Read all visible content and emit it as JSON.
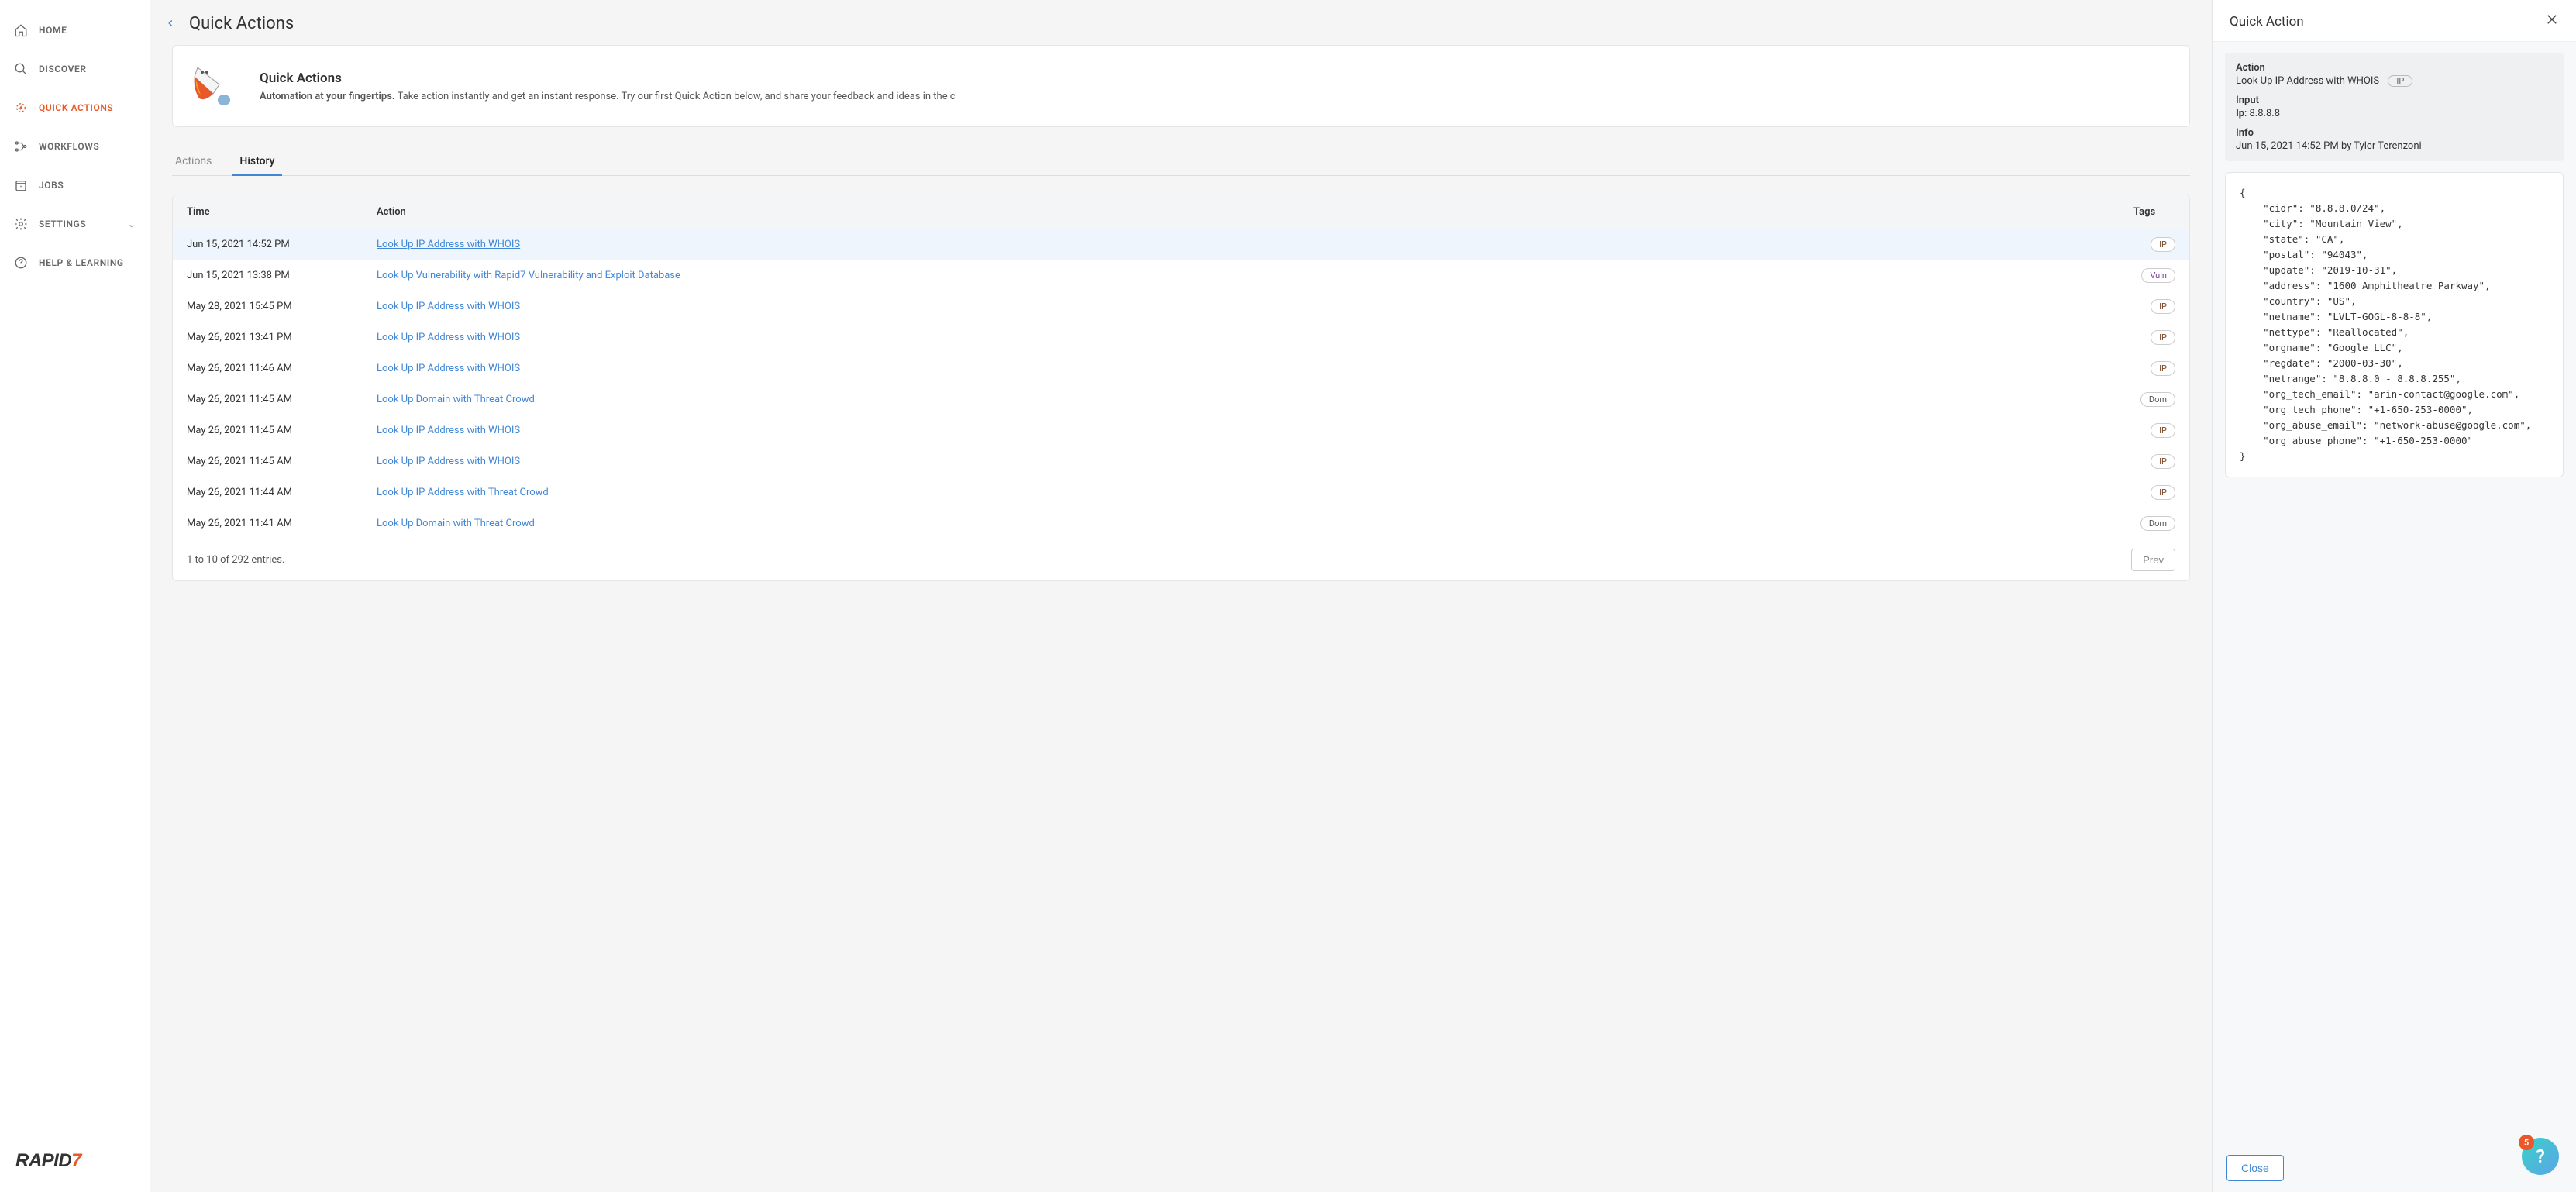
{
  "sidebar": {
    "items": [
      {
        "label": "HOME",
        "icon": "home-icon"
      },
      {
        "label": "DISCOVER",
        "icon": "search-icon"
      },
      {
        "label": "QUICK ACTIONS",
        "icon": "spark-icon"
      },
      {
        "label": "WORKFLOWS",
        "icon": "workflow-icon"
      },
      {
        "label": "JOBS",
        "icon": "jobs-icon"
      },
      {
        "label": "SETTINGS",
        "icon": "gear-icon"
      },
      {
        "label": "HELP & LEARNING",
        "icon": "help-icon"
      }
    ],
    "logo": {
      "name": "RAPID",
      "accent": "7"
    }
  },
  "header": {
    "title": "Quick Actions"
  },
  "banner": {
    "title": "Quick Actions",
    "lead": "Automation at your fingertips.",
    "body": "Take action instantly and get an instant response. Try our first Quick Action below, and share your feedback and ideas in the c"
  },
  "tabs": {
    "actions": "Actions",
    "history": "History"
  },
  "table": {
    "headers": {
      "time": "Time",
      "action": "Action",
      "tags": "Tags"
    },
    "rows": [
      {
        "time": "Jun 15, 2021 14:52 PM",
        "action": "Look Up IP Address with WHOIS",
        "tag": "IP",
        "selected": true
      },
      {
        "time": "Jun 15, 2021 13:38 PM",
        "action": "Look Up Vulnerability with Rapid7 Vulnerability and Exploit Database",
        "tag": "Vuln"
      },
      {
        "time": "May 28, 2021 15:45 PM",
        "action": "Look Up IP Address with WHOIS",
        "tag": "IP"
      },
      {
        "time": "May 26, 2021 13:41 PM",
        "action": "Look Up IP Address with WHOIS",
        "tag": "IP"
      },
      {
        "time": "May 26, 2021 11:46 AM",
        "action": "Look Up IP Address with WHOIS",
        "tag": "IP"
      },
      {
        "time": "May 26, 2021 11:45 AM",
        "action": "Look Up Domain with Threat Crowd",
        "tag": "Dom"
      },
      {
        "time": "May 26, 2021 11:45 AM",
        "action": "Look Up IP Address with WHOIS",
        "tag": "IP"
      },
      {
        "time": "May 26, 2021 11:45 AM",
        "action": "Look Up IP Address with WHOIS",
        "tag": "IP"
      },
      {
        "time": "May 26, 2021 11:44 AM",
        "action": "Look Up IP Address with Threat Crowd",
        "tag": "IP"
      },
      {
        "time": "May 26, 2021 11:41 AM",
        "action": "Look Up Domain with Threat Crowd",
        "tag": "Dom"
      }
    ],
    "footer": {
      "info": "1 to 10 of 292 entries.",
      "prev": "Prev"
    }
  },
  "panel": {
    "title": "Quick Action",
    "action_label": "Action",
    "action_value": "Look Up IP Address with WHOIS",
    "action_chip": "IP",
    "input_label": "Input",
    "input_key": "Ip",
    "input_value": "8.8.8.8",
    "info_label": "Info",
    "info_value": "Jun 15, 2021 14:52 PM by Tyler Terenzoni",
    "json": "{\n    \"cidr\": \"8.8.8.0/24\",\n    \"city\": \"Mountain View\",\n    \"state\": \"CA\",\n    \"postal\": \"94043\",\n    \"update\": \"2019-10-31\",\n    \"address\": \"1600 Amphitheatre Parkway\",\n    \"country\": \"US\",\n    \"netname\": \"LVLT-GOGL-8-8-8\",\n    \"nettype\": \"Reallocated\",\n    \"orgname\": \"Google LLC\",\n    \"regdate\": \"2000-03-30\",\n    \"netrange\": \"8.8.8.0 - 8.8.8.255\",\n    \"org_tech_email\": \"arin-contact@google.com\",\n    \"org_tech_phone\": \"+1-650-253-0000\",\n    \"org_abuse_email\": \"network-abuse@google.com\",\n    \"org_abuse_phone\": \"+1-650-253-0000\"\n}",
    "close": "Close"
  },
  "help": {
    "badge": "5"
  }
}
